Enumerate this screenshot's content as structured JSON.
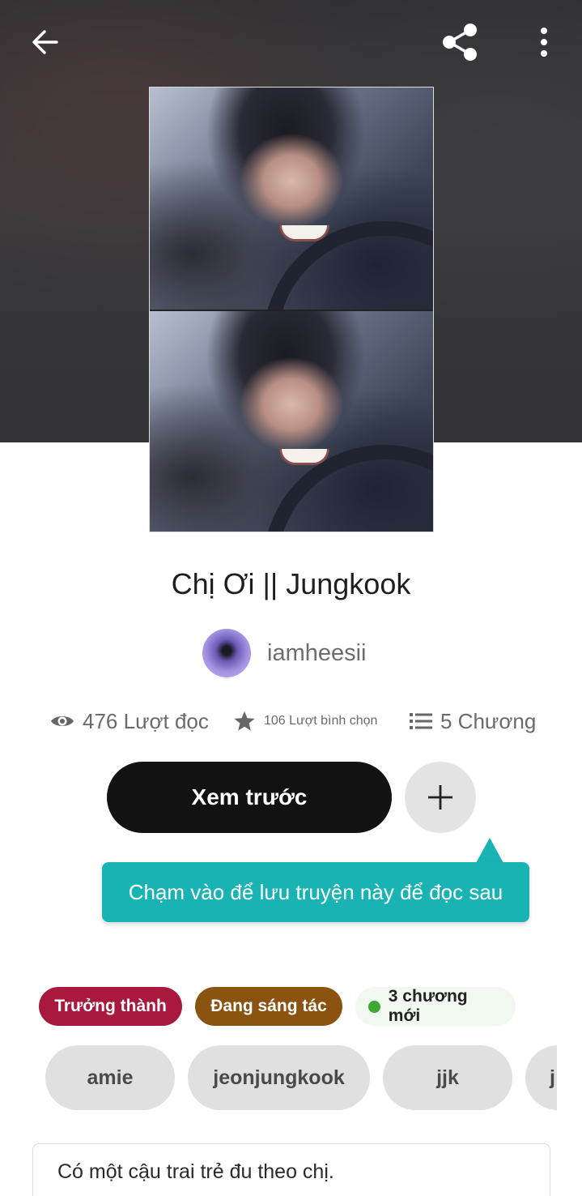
{
  "story": {
    "title": "Chị Ơi || Jungkook",
    "author": "iamheesii"
  },
  "stats": {
    "reads": "476 Lượt đọc",
    "votes": "106 Lượt bình chọn",
    "chapters": "5 Chương"
  },
  "actions": {
    "preview_label": "Xem trước",
    "tooltip": "Chạm vào để lưu truyện này để đọc sau"
  },
  "badges": {
    "mature": "Trưởng thành",
    "ongoing": "Đang sáng tác",
    "new_chapters": "3 chương mới"
  },
  "tags": [
    "amie",
    "jeonjungkook",
    "jjk",
    "j"
  ],
  "description": "Có một cậu trai trẻ đu theo chị.",
  "icons": {
    "back": "arrow-left-icon",
    "share": "share-icon",
    "more": "more-vertical-icon",
    "eye": "eye-icon",
    "star": "star-icon",
    "list": "list-icon",
    "plus": "plus-icon"
  },
  "colors": {
    "primary_button": "#121212",
    "tooltip": "#1ab3b3",
    "mature_badge": "#a8183f",
    "ongoing_badge": "#8a5310",
    "new_dot": "#3aa832"
  }
}
